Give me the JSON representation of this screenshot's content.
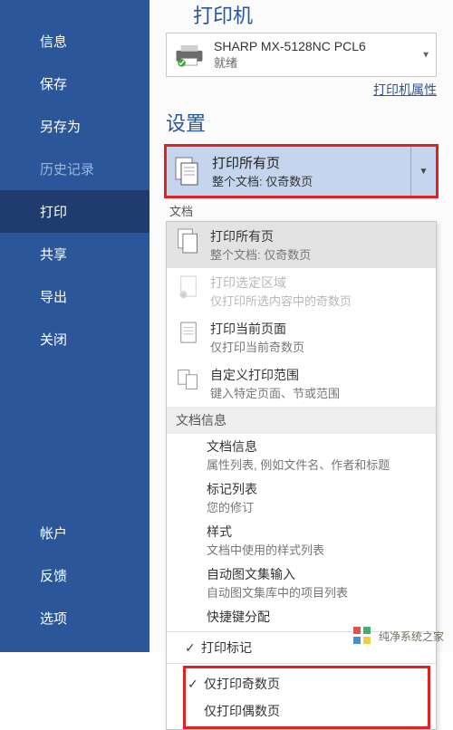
{
  "sidebar": {
    "items_top": [
      {
        "label": "信息",
        "name": "nav-info"
      },
      {
        "label": "保存",
        "name": "nav-save"
      },
      {
        "label": "另存为",
        "name": "nav-save-as"
      },
      {
        "label": "历史记录",
        "name": "nav-history",
        "disabled": true
      },
      {
        "label": "打印",
        "name": "nav-print",
        "selected": true
      },
      {
        "label": "共享",
        "name": "nav-share"
      },
      {
        "label": "导出",
        "name": "nav-export"
      },
      {
        "label": "关闭",
        "name": "nav-close"
      }
    ],
    "items_bottom": [
      {
        "label": "帐户",
        "name": "nav-account"
      },
      {
        "label": "反馈",
        "name": "nav-feedback"
      },
      {
        "label": "选项",
        "name": "nav-options"
      }
    ]
  },
  "printer_section": {
    "heading": "打印机",
    "name": "SHARP MX-5128NC PCL6",
    "status": "就绪",
    "properties_link": "打印机属性"
  },
  "settings_section": {
    "heading": "设置",
    "selected": {
      "title": "打印所有页",
      "subtitle": "整个文档: 仅奇数页"
    },
    "below_label": "文档"
  },
  "dropdown": {
    "opt_all": {
      "title": "打印所有页",
      "subtitle": "整个文档: 仅奇数页"
    },
    "opt_selection": {
      "title": "打印选定区域",
      "subtitle": "仅打印所选内容中的奇数页"
    },
    "opt_current": {
      "title": "打印当前页面",
      "subtitle": "仅打印当前奇数页"
    },
    "opt_custom": {
      "title": "自定义打印范围",
      "subtitle": "键入特定页面、节或范围"
    },
    "group_docinfo": "文档信息",
    "sub_docinfo": {
      "title": "文档信息",
      "subtitle": "属性列表, 例如文件名、作者和标题"
    },
    "sub_markup": {
      "title": "标记列表",
      "subtitle": "您的修订"
    },
    "sub_styles": {
      "title": "样式",
      "subtitle": "文档中使用的样式列表"
    },
    "sub_autotext": {
      "title": "自动图文集输入",
      "subtitle": "自动图文集库中的项目列表"
    },
    "sub_keys": {
      "title": "快捷键分配"
    },
    "check_marks": "打印标记",
    "check_odd": "仅打印奇数页",
    "check_even": "仅打印偶数页"
  },
  "watermark": "纯净系统之家"
}
